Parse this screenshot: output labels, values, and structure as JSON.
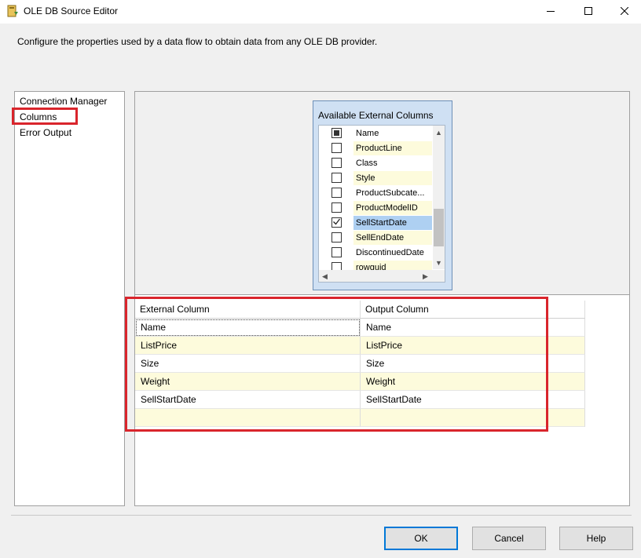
{
  "window": {
    "title": "OLE DB Source Editor",
    "description": "Configure the properties used by a data flow to obtain data from any OLE DB provider."
  },
  "nav": {
    "items": [
      {
        "label": "Connection Manager"
      },
      {
        "label": "Columns",
        "selected": true
      },
      {
        "label": "Error Output"
      }
    ]
  },
  "available_columns": {
    "title": "Available External Columns",
    "rows": [
      {
        "name": "Name",
        "checked": "indeterminate"
      },
      {
        "name": "ProductLine",
        "checked": false
      },
      {
        "name": "Class",
        "checked": false
      },
      {
        "name": "Style",
        "checked": false
      },
      {
        "name": "ProductSubcate...",
        "checked": false
      },
      {
        "name": "ProductModelID",
        "checked": false
      },
      {
        "name": "SellStartDate",
        "checked": true
      },
      {
        "name": "SellEndDate",
        "checked": false
      },
      {
        "name": "DiscontinuedDate",
        "checked": false
      },
      {
        "name": "rowguid",
        "checked": false
      }
    ]
  },
  "mapping": {
    "headers": {
      "external": "External Column",
      "output": "Output Column"
    },
    "rows": [
      {
        "external": "Name",
        "output": "Name"
      },
      {
        "external": "ListPrice",
        "output": "ListPrice"
      },
      {
        "external": "Size",
        "output": "Size"
      },
      {
        "external": "Weight",
        "output": "Weight"
      },
      {
        "external": "SellStartDate",
        "output": "SellStartDate"
      },
      {
        "external": "",
        "output": ""
      }
    ]
  },
  "buttons": {
    "ok": "OK",
    "cancel": "Cancel",
    "help": "Help"
  },
  "colors": {
    "highlight": "#d9252c",
    "selected_row": "#aed0f2",
    "alt_row": "#fdfbdc",
    "focus_border": "#0078d7"
  },
  "icons": {
    "app": "ole-db-source-icon",
    "minimize": "minimize-icon",
    "maximize": "maximize-icon",
    "close": "close-icon",
    "checkmark": "checkmark-icon"
  }
}
